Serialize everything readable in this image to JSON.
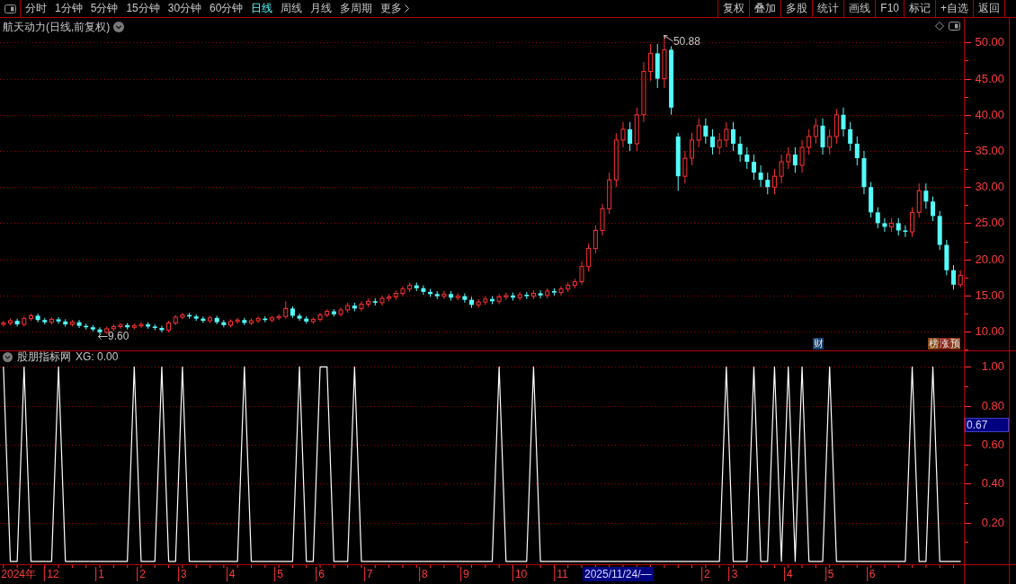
{
  "toolbar": {
    "periods": [
      {
        "label": "分时",
        "kind": "period",
        "selected": false
      },
      {
        "label": "1分钟",
        "kind": "period",
        "selected": false
      },
      {
        "label": "5分钟",
        "kind": "period",
        "selected": false
      },
      {
        "label": "15分钟",
        "kind": "period",
        "selected": false
      },
      {
        "label": "30分钟",
        "kind": "period",
        "selected": false
      },
      {
        "label": "60分钟",
        "kind": "period",
        "selected": false
      },
      {
        "label": "日线",
        "kind": "period",
        "selected": true
      },
      {
        "label": "周线",
        "kind": "period",
        "selected": false
      },
      {
        "label": "月线",
        "kind": "period",
        "selected": false
      },
      {
        "label": "多周期",
        "kind": "period",
        "selected": false
      },
      {
        "label": "更多",
        "kind": "menu",
        "selected": false
      }
    ],
    "buttons": [
      "复权",
      "叠加",
      "多股",
      "统计",
      "画线",
      "F10",
      "标记",
      "+自选",
      "返回"
    ]
  },
  "price_chart": {
    "title": "航天动力(日线,前复权)",
    "event_markers": [
      {
        "text": "财",
        "color": "#123f6e"
      },
      {
        "text": "榜",
        "color": "#8a4a16"
      },
      {
        "text": "涨",
        "color": "#8c1d12"
      },
      {
        "text": "预",
        "color": "#8c3a14"
      }
    ],
    "chart_data": [
      {
        "type": "candlestick",
        "ylim": [
          7.4,
          53.4
        ],
        "yticks": [
          {
            "value": 50,
            "label": "50.00"
          },
          {
            "value": 45,
            "label": "45.00"
          },
          {
            "value": 40,
            "label": "40.00"
          },
          {
            "value": 35,
            "label": "35.00"
          },
          {
            "value": 30,
            "label": "30.00"
          },
          {
            "value": 25,
            "label": "25.00"
          },
          {
            "value": 20,
            "label": "20.00"
          },
          {
            "value": 15,
            "label": "15.00"
          },
          {
            "value": 10,
            "label": "10.00"
          }
        ],
        "grid": true,
        "annotations": [
          "50.88",
          "9.60"
        ],
        "ohlc": [
          [
            11.0,
            11.5,
            10.7,
            11.2
          ],
          [
            11.2,
            11.8,
            10.9,
            11.5
          ],
          [
            11.5,
            11.8,
            10.7,
            11.0
          ],
          [
            11.0,
            12.1,
            10.7,
            11.8
          ],
          [
            11.8,
            12.5,
            11.5,
            12.2
          ],
          [
            12.2,
            12.5,
            11.3,
            11.6
          ],
          [
            11.6,
            11.9,
            11.0,
            11.3
          ],
          [
            11.3,
            12.0,
            11.0,
            11.7
          ],
          [
            11.7,
            12.0,
            11.1,
            11.4
          ],
          [
            11.4,
            11.7,
            10.7,
            11.0
          ],
          [
            11.0,
            11.6,
            10.7,
            11.3
          ],
          [
            11.3,
            11.6,
            10.5,
            10.8
          ],
          [
            10.8,
            11.1,
            10.3,
            10.6
          ],
          [
            10.6,
            10.9,
            10.0,
            10.3
          ],
          [
            10.3,
            10.6,
            9.6,
            9.9
          ],
          [
            9.9,
            10.7,
            9.7,
            10.4
          ],
          [
            10.4,
            11.0,
            10.1,
            10.7
          ],
          [
            10.7,
            11.2,
            10.4,
            10.9
          ],
          [
            10.9,
            11.2,
            10.3,
            10.6
          ],
          [
            10.6,
            11.1,
            10.3,
            10.8
          ],
          [
            10.8,
            11.3,
            10.5,
            11.0
          ],
          [
            11.0,
            11.3,
            10.4,
            10.7
          ],
          [
            10.7,
            11.0,
            10.2,
            10.5
          ],
          [
            10.5,
            10.8,
            9.9,
            10.2
          ],
          [
            10.2,
            11.5,
            9.9,
            11.2
          ],
          [
            11.2,
            12.3,
            10.9,
            12.0
          ],
          [
            12.0,
            12.6,
            11.7,
            12.3
          ],
          [
            12.3,
            12.6,
            11.8,
            12.1
          ],
          [
            12.1,
            12.4,
            11.5,
            11.8
          ],
          [
            11.8,
            12.1,
            11.2,
            11.5
          ],
          [
            11.5,
            12.2,
            11.2,
            11.9
          ],
          [
            11.9,
            12.2,
            11.0,
            11.3
          ],
          [
            11.3,
            11.6,
            10.6,
            10.9
          ],
          [
            10.9,
            11.7,
            10.6,
            11.4
          ],
          [
            11.4,
            11.9,
            11.1,
            11.6
          ],
          [
            11.6,
            11.9,
            10.9,
            11.2
          ],
          [
            11.2,
            11.8,
            10.9,
            11.5
          ],
          [
            11.5,
            12.1,
            11.2,
            11.8
          ],
          [
            11.8,
            12.1,
            11.3,
            11.6
          ],
          [
            11.6,
            12.2,
            11.3,
            11.9
          ],
          [
            11.9,
            12.4,
            11.6,
            12.1
          ],
          [
            12.1,
            14.2,
            11.8,
            13.2
          ],
          [
            13.2,
            13.5,
            11.9,
            12.2
          ],
          [
            12.2,
            12.5,
            11.5,
            11.8
          ],
          [
            11.8,
            12.1,
            11.1,
            11.4
          ],
          [
            11.4,
            12.0,
            11.1,
            11.7
          ],
          [
            11.7,
            12.6,
            11.4,
            12.3
          ],
          [
            12.3,
            13.1,
            12.0,
            12.8
          ],
          [
            12.8,
            13.1,
            12.1,
            12.4
          ],
          [
            12.4,
            13.3,
            12.1,
            13.0
          ],
          [
            13.0,
            14.0,
            12.6,
            13.6
          ],
          [
            13.6,
            14.0,
            12.8,
            13.2
          ],
          [
            13.2,
            14.2,
            12.8,
            13.8
          ],
          [
            13.8,
            14.6,
            13.4,
            14.2
          ],
          [
            14.2,
            14.6,
            13.6,
            14.0
          ],
          [
            14.0,
            15.0,
            13.6,
            14.6
          ],
          [
            14.6,
            15.2,
            14.2,
            14.8
          ],
          [
            14.8,
            15.7,
            14.4,
            15.3
          ],
          [
            15.3,
            16.3,
            14.9,
            15.9
          ],
          [
            15.9,
            16.8,
            15.5,
            16.4
          ],
          [
            16.4,
            16.8,
            15.6,
            16.0
          ],
          [
            16.0,
            16.4,
            15.1,
            15.5
          ],
          [
            15.5,
            15.9,
            14.8,
            15.2
          ],
          [
            15.2,
            15.6,
            14.5,
            14.9
          ],
          [
            14.9,
            15.6,
            14.5,
            15.2
          ],
          [
            15.2,
            15.6,
            14.3,
            14.7
          ],
          [
            14.7,
            15.3,
            14.3,
            14.9
          ],
          [
            14.9,
            15.3,
            14.0,
            14.4
          ],
          [
            14.4,
            14.8,
            13.3,
            13.7
          ],
          [
            13.7,
            14.5,
            13.3,
            14.1
          ],
          [
            14.1,
            14.9,
            13.7,
            14.5
          ],
          [
            14.5,
            14.9,
            13.8,
            14.2
          ],
          [
            14.2,
            15.2,
            13.8,
            14.8
          ],
          [
            14.8,
            15.4,
            14.4,
            15.0
          ],
          [
            15.0,
            15.4,
            14.3,
            14.7
          ],
          [
            14.7,
            15.5,
            14.3,
            15.1
          ],
          [
            15.1,
            15.5,
            14.5,
            14.9
          ],
          [
            14.9,
            15.7,
            14.5,
            15.3
          ],
          [
            15.3,
            15.7,
            14.6,
            15.0
          ],
          [
            15.0,
            16.0,
            14.6,
            15.6
          ],
          [
            15.6,
            16.0,
            15.0,
            15.4
          ],
          [
            15.4,
            16.3,
            15.0,
            15.9
          ],
          [
            15.9,
            16.8,
            15.5,
            16.4
          ],
          [
            16.4,
            17.3,
            16.0,
            16.9
          ],
          [
            16.9,
            19.7,
            16.5,
            19.0
          ],
          [
            19.0,
            22.2,
            18.3,
            21.5
          ],
          [
            21.5,
            24.7,
            20.8,
            24.0
          ],
          [
            24.0,
            27.7,
            23.3,
            27.0
          ],
          [
            27.0,
            32.0,
            26.3,
            31.0
          ],
          [
            31.0,
            37.5,
            30.0,
            36.5
          ],
          [
            36.5,
            39.0,
            35.5,
            38.0
          ],
          [
            38.0,
            39.0,
            35.0,
            36.0
          ],
          [
            36.0,
            41.0,
            35.0,
            40.0
          ],
          [
            40.0,
            47.3,
            39.0,
            46.0
          ],
          [
            46.0,
            49.8,
            44.7,
            48.5
          ],
          [
            48.5,
            49.8,
            43.7,
            45.0
          ],
          [
            45.0,
            50.88,
            43.7,
            49.0
          ],
          [
            49.0,
            49.5,
            40.0,
            41.0
          ],
          [
            37.0,
            37.5,
            29.5,
            31.5
          ],
          [
            31.5,
            35.0,
            30.5,
            34.0
          ],
          [
            34.0,
            37.5,
            33.0,
            36.5
          ],
          [
            36.5,
            39.5,
            35.5,
            38.5
          ],
          [
            38.5,
            39.5,
            36.0,
            37.0
          ],
          [
            37.0,
            38.0,
            34.5,
            35.5
          ],
          [
            35.5,
            37.5,
            34.5,
            36.5
          ],
          [
            36.5,
            39.0,
            35.5,
            38.0
          ],
          [
            38.0,
            39.0,
            35.0,
            36.0
          ],
          [
            36.0,
            37.0,
            33.5,
            34.5
          ],
          [
            34.5,
            35.5,
            32.5,
            33.5
          ],
          [
            33.5,
            34.5,
            31.0,
            32.0
          ],
          [
            32.0,
            33.0,
            30.0,
            31.0
          ],
          [
            31.0,
            32.0,
            29.0,
            30.0
          ],
          [
            30.0,
            32.5,
            29.0,
            31.5
          ],
          [
            31.5,
            34.5,
            30.5,
            33.5
          ],
          [
            33.5,
            35.5,
            32.5,
            34.5
          ],
          [
            34.5,
            35.5,
            32.0,
            33.0
          ],
          [
            33.0,
            36.5,
            32.0,
            35.5
          ],
          [
            35.5,
            38.0,
            34.5,
            37.0
          ],
          [
            37.0,
            39.5,
            36.0,
            38.5
          ],
          [
            38.5,
            39.5,
            34.5,
            35.5
          ],
          [
            35.5,
            38.0,
            34.5,
            37.0
          ],
          [
            37.0,
            40.8,
            36.0,
            40.0
          ],
          [
            40.0,
            41.0,
            37.0,
            38.0
          ],
          [
            38.0,
            39.0,
            35.0,
            36.0
          ],
          [
            36.0,
            37.0,
            33.0,
            34.0
          ],
          [
            34.0,
            35.0,
            29.0,
            30.0
          ],
          [
            30.0,
            30.7,
            25.8,
            26.5
          ],
          [
            26.5,
            27.2,
            24.3,
            25.0
          ],
          [
            25.0,
            25.7,
            23.8,
            24.5
          ],
          [
            24.5,
            25.7,
            23.8,
            25.0
          ],
          [
            25.0,
            25.7,
            23.3,
            24.0
          ],
          [
            24.0,
            24.7,
            23.1,
            23.8
          ],
          [
            23.8,
            27.2,
            23.1,
            26.5
          ],
          [
            26.5,
            30.5,
            25.8,
            29.5
          ],
          [
            29.5,
            30.5,
            27.0,
            28.0
          ],
          [
            28.0,
            28.7,
            25.3,
            26.0
          ],
          [
            26.0,
            26.7,
            21.3,
            22.0
          ],
          [
            22.0,
            22.7,
            17.8,
            18.5
          ],
          [
            18.5,
            19.2,
            15.8,
            16.5
          ],
          [
            16.5,
            18.5,
            16.1,
            17.8
          ]
        ]
      }
    ]
  },
  "indicator": {
    "name": "股朋指标网",
    "value_label": "XG: 0.00",
    "cursor_value": "0.67",
    "chart_data": [
      {
        "type": "line",
        "color": "#ffffff",
        "ylim": [
          -0.01,
          1.08
        ],
        "yticks": [
          {
            "value": 1,
            "label": "1.00"
          },
          {
            "value": 0.8,
            "label": "0.80"
          },
          {
            "value": 0.6,
            "label": "0.60"
          },
          {
            "value": 0.4,
            "label": "0.40"
          },
          {
            "value": 0.2,
            "label": "0.20"
          }
        ],
        "grid": true,
        "values": [
          1,
          0,
          0,
          1,
          0,
          0,
          0,
          0,
          1,
          0,
          0,
          0,
          0,
          0,
          0,
          0,
          0,
          0,
          0,
          1,
          0,
          0,
          0,
          1,
          0,
          0,
          1,
          0,
          0,
          0,
          0,
          0,
          0,
          0,
          0,
          1,
          0,
          0,
          0,
          0,
          0,
          0,
          0,
          1,
          0,
          0,
          1,
          1,
          0,
          0,
          0,
          1,
          0,
          0,
          0,
          0,
          0,
          0,
          0,
          0,
          0,
          0,
          0,
          0,
          0,
          0,
          0,
          0,
          0,
          0,
          0,
          0,
          1,
          0,
          0,
          0,
          0,
          1,
          0,
          0,
          0,
          0,
          0,
          0,
          0,
          0,
          0,
          0,
          0,
          0,
          0,
          0,
          0,
          0,
          0,
          0,
          0,
          0,
          0,
          0,
          0,
          0,
          0,
          0,
          0,
          1,
          0,
          0,
          0,
          1,
          0,
          0,
          1,
          0,
          1,
          0,
          1,
          0,
          0,
          0,
          1,
          0,
          0,
          0,
          0,
          0,
          0,
          0,
          0,
          0,
          0,
          0,
          1,
          0,
          0,
          1,
          0,
          0,
          0,
          0
        ],
        "categories": [
          null,
          null,
          "2024年",
          null,
          null,
          null,
          null,
          "12",
          null,
          null,
          null,
          null,
          null,
          null,
          "1",
          null,
          null,
          null,
          null,
          null,
          "2",
          null,
          null,
          null,
          null,
          null,
          "3",
          null,
          null,
          null,
          null,
          null,
          null,
          "4",
          null,
          null,
          null,
          null,
          null,
          null,
          "5",
          null,
          null,
          null,
          null,
          null,
          "6",
          null,
          null,
          null,
          null,
          null,
          null,
          "7",
          null,
          null,
          null,
          null,
          null,
          null,
          null,
          "8",
          null,
          null,
          null,
          null,
          null,
          "9",
          null,
          null,
          null,
          null,
          null,
          null,
          null,
          "10",
          null,
          null,
          null,
          null,
          null,
          "11",
          null,
          null,
          null,
          null,
          null,
          null,
          null,
          null,
          null,
          null,
          null,
          null,
          null,
          null,
          null,
          null,
          null,
          null,
          null,
          null,
          "2",
          null,
          null,
          null,
          "3",
          null,
          null,
          null,
          null,
          null,
          null,
          null,
          "4",
          null,
          null,
          null,
          null,
          null,
          "5",
          null,
          null,
          null,
          null,
          null,
          "6",
          null,
          null,
          null,
          null,
          null,
          null,
          null,
          null,
          null,
          null,
          null,
          null,
          null
        ]
      }
    ]
  },
  "time_axis": {
    "cursor_date": "2025/11/24/—"
  }
}
